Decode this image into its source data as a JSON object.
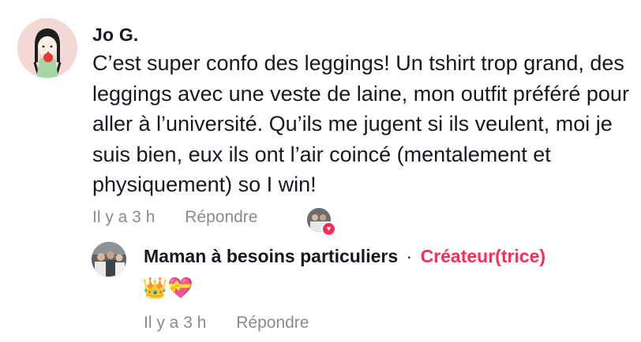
{
  "comment": {
    "author": "Jo G.",
    "text": "C’est super confo des leggings! Un tshirt trop grand, des leggings avec une veste de laine, mon outfit préféré pour aller à l’université. Qu’ils me jugent si ils veulent, moi je suis bien, eux ils ont l’air coincé (mentalement et physiquement) so I win!",
    "time": "Il y a 3 h",
    "reply_label": "Répondre",
    "avatar_icon": "illustrated-girl-avatar",
    "liked_by_creator_icon": "heart-icon"
  },
  "reply": {
    "author": "Maman à besoins particuliers",
    "separator": "·",
    "badge": "Créateur(trice)",
    "text": "👑💝",
    "time": "Il y a 3 h",
    "reply_label": "Répondre",
    "avatar_icon": "group-photo-avatar"
  },
  "colors": {
    "accent": "#fe2c55",
    "meta": "#8a8b91",
    "text": "#161823"
  }
}
